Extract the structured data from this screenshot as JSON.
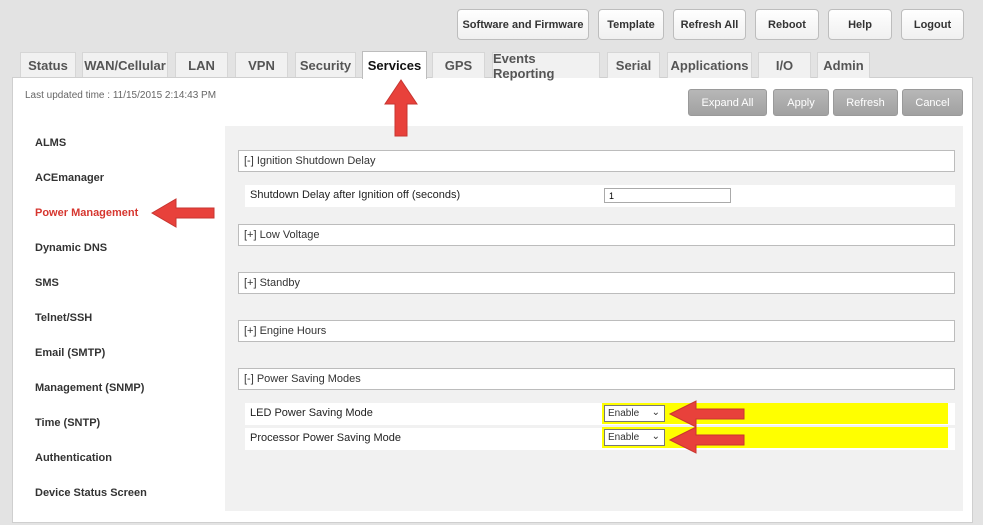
{
  "toolbar": {
    "software_firmware": "Software and Firmware",
    "template": "Template",
    "refresh_all": "Refresh All",
    "reboot": "Reboot",
    "help": "Help",
    "logout": "Logout"
  },
  "tabs": [
    "Status",
    "WAN/Cellular",
    "LAN",
    "VPN",
    "Security",
    "Services",
    "GPS",
    "Events Reporting",
    "Serial",
    "Applications",
    "I/O",
    "Admin"
  ],
  "last_updated": "Last updated time : 11/15/2015 2:14:43 PM",
  "actions": {
    "expand_all": "Expand All",
    "apply": "Apply",
    "refresh": "Refresh",
    "cancel": "Cancel"
  },
  "sidebar": [
    "ALMS",
    "ACEmanager",
    "Power Management",
    "Dynamic DNS",
    "SMS",
    "Telnet/SSH",
    "Email (SMTP)",
    "Management (SNMP)",
    "Time (SNTP)",
    "Authentication",
    "Device Status Screen"
  ],
  "sections": {
    "ignition": "[-] Ignition Shutdown Delay",
    "low_voltage": "[+] Low Voltage",
    "standby": "[+] Standby",
    "engine_hours": "[+] Engine Hours",
    "power_saving": "[-] Power Saving Modes"
  },
  "fields": {
    "shutdown_delay_label": "Shutdown Delay after Ignition off (seconds)",
    "shutdown_delay_value": "1",
    "led_label": "LED Power Saving Mode",
    "led_value": "Enable",
    "processor_label": "Processor Power Saving Mode",
    "processor_value": "Enable"
  },
  "colors": {
    "highlight": "#ffff00",
    "arrow": "#e8413b",
    "active_sidebar": "#d6362f"
  },
  "icons": {
    "select_chevron": "⌄"
  }
}
